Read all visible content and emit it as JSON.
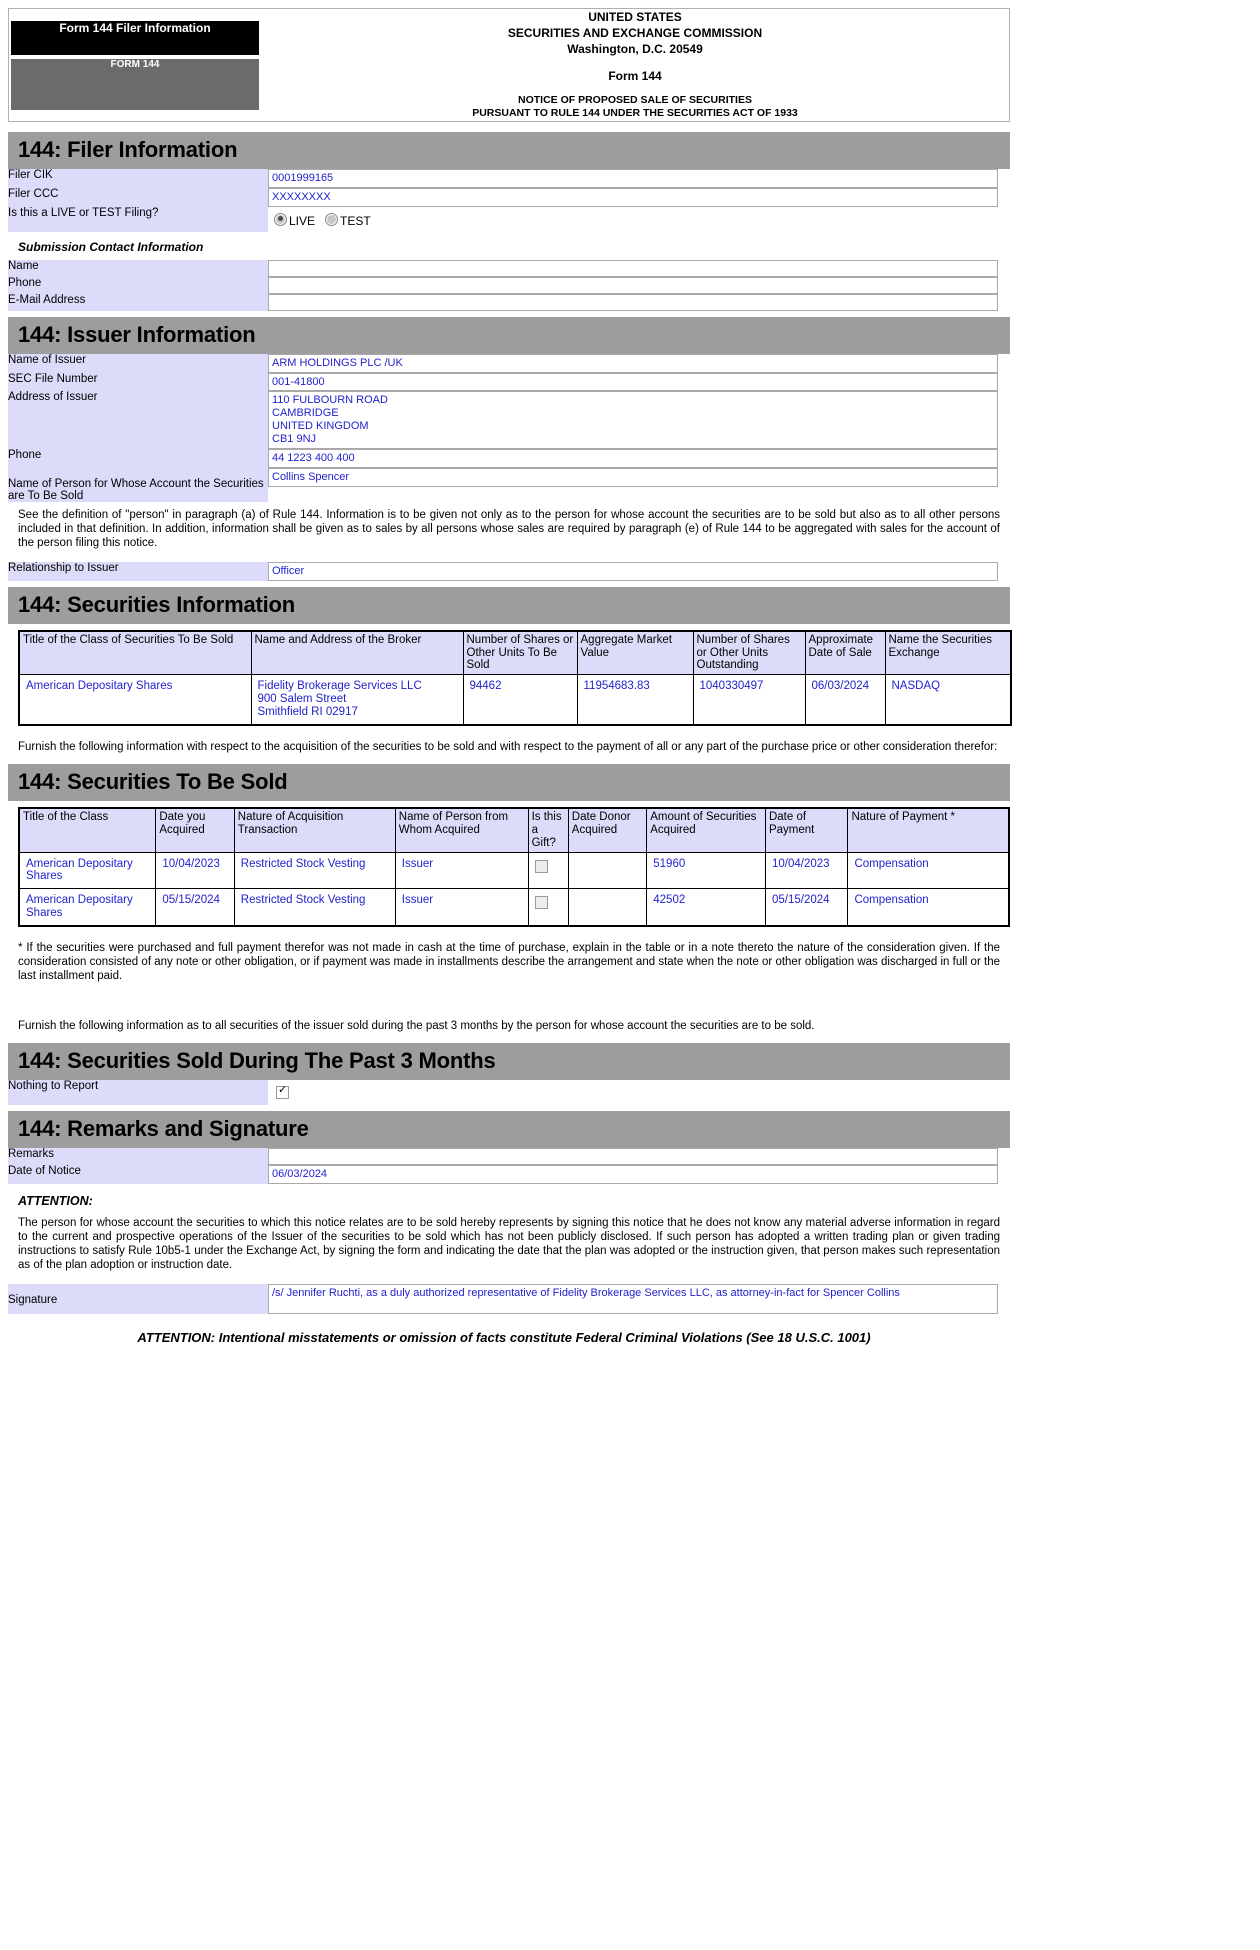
{
  "masthead": {
    "tab_label": "Form 144 Filer Information",
    "form_tag": "FORM 144",
    "line1": "UNITED STATES",
    "line2": "SECURITIES AND EXCHANGE COMMISSION",
    "line3": "Washington, D.C. 20549",
    "form_title": "Form 144",
    "notice1": "NOTICE OF PROPOSED SALE OF SECURITIES",
    "notice2": "PURSUANT TO RULE 144 UNDER THE SECURITIES ACT OF 1933"
  },
  "filer_section": {
    "heading": "144: Filer Information",
    "cik_label": "Filer CIK",
    "cik_value": "0001999165",
    "ccc_label": "Filer CCC",
    "ccc_value": "XXXXXXXX",
    "live_test_label": "Is this a LIVE or TEST Filing?",
    "live_label": "LIVE",
    "test_label": "TEST",
    "live_selected": true,
    "contact_subhead": "Submission Contact Information",
    "contact_name_label": "Name",
    "contact_name_value": "",
    "contact_phone_label": "Phone",
    "contact_phone_value": "",
    "contact_email_label": "E-Mail Address",
    "contact_email_value": ""
  },
  "issuer_section": {
    "heading": "144: Issuer Information",
    "name_label": "Name of Issuer",
    "name_value": "ARM HOLDINGS PLC /UK",
    "sec_file_label": "SEC File Number",
    "sec_file_value": "001-41800",
    "address_label": "Address of Issuer",
    "address_value": "110 FULBOURN ROAD\nCAMBRIDGE\nUNITED KINGDOM\nCB1 9NJ",
    "phone_label": "Phone",
    "phone_value": "44 1223 400 400",
    "person_label": "Name of Person for Whose Account the Securities are To Be Sold",
    "person_value": "Collins Spencer",
    "definition_paragraph": "See the definition of \"person\" in paragraph (a) of Rule 144. Information is to be given not only as to the person for whose account the securities are to be sold but also as to all other persons included in that definition. In addition, information shall be given as to sales by all persons whose sales are required by paragraph (e) of Rule 144 to be aggregated with sales for the account of the person filing this notice.",
    "relationship_label": "Relationship to Issuer",
    "relationship_value": "Officer"
  },
  "securities_info": {
    "heading": "144: Securities Information",
    "columns": [
      "Title of the Class of Securities To Be Sold",
      "Name and Address of the Broker",
      "Number of Shares or Other Units To Be Sold",
      "Aggregate Market Value",
      "Number of Shares or Other Units Outstanding",
      "Approximate Date of Sale",
      "Name the Securities Exchange"
    ],
    "rows": [
      {
        "title": "American Depositary Shares",
        "broker": "Fidelity Brokerage Services LLC\n900 Salem Street\nSmithfield  RI  02917",
        "units_to_sell": "94462",
        "market_value": "11954683.83",
        "units_outstanding": "1040330497",
        "date_of_sale": "06/03/2024",
        "exchange": "NASDAQ"
      }
    ]
  },
  "furnish_paragraph_1": "Furnish the following information with respect to the acquisition of the securities to be sold and with respect to the payment of all or any part of the purchase price or other consideration therefor:",
  "securities_to_be_sold": {
    "heading": "144: Securities To Be Sold",
    "columns": [
      "Title of the Class",
      "Date you Acquired",
      "Nature of Acquisition Transaction",
      "Name of Person from Whom Acquired",
      "Is this a Gift?",
      "Date Donor Acquired",
      "Amount of Securities Acquired",
      "Date of Payment",
      "Nature of Payment *"
    ],
    "rows": [
      {
        "title": "American Depositary Shares",
        "date_acquired": "10/04/2023",
        "nature": "Restricted Stock Vesting",
        "from_whom": "Issuer",
        "is_gift": false,
        "donor_date": "",
        "amount": "51960",
        "date_of_payment": "10/04/2023",
        "nature_of_payment": "Compensation"
      },
      {
        "title": "American Depositary Shares",
        "date_acquired": "05/15/2024",
        "nature": "Restricted Stock Vesting",
        "from_whom": "Issuer",
        "is_gift": false,
        "donor_date": "",
        "amount": "42502",
        "date_of_payment": "05/15/2024",
        "nature_of_payment": "Compensation"
      }
    ]
  },
  "footnote": "* If the securities were purchased and full payment therefor was not made in cash at the time of purchase, explain in the table or in a note thereto the nature of the consideration given. If the consideration consisted of any note or other obligation, or if payment was made in installments describe the arrangement and state when the note or other obligation was discharged in full or the last installment paid.",
  "furnish_paragraph_2": "Furnish the following information as to all securities of the issuer sold during the past 3 months by the person for whose account the securities are to be sold.",
  "sold_past_3_months": {
    "heading": "144: Securities Sold During The Past 3 Months",
    "nothing_label": "Nothing to Report",
    "nothing_checked": true
  },
  "remarks_section": {
    "heading": "144: Remarks and Signature",
    "remarks_label": "Remarks",
    "remarks_value": "",
    "date_of_notice_label": "Date of Notice",
    "date_of_notice_value": "06/03/2024",
    "attention_title": "ATTENTION:",
    "attention_paragraph": "The person for whose account the securities to which this notice relates are to be sold hereby represents by signing this notice that he does not know any material adverse information in regard to the current and prospective operations of the Issuer of the securities to be sold which has not been publicly disclosed. If such person has adopted a written trading plan or given trading instructions to satisfy Rule 10b5-1 under the Exchange Act, by signing the form and indicating the date that the plan was adopted or the instruction given, that person makes such representation as of the plan adoption or instruction date.",
    "signature_label": "Signature",
    "signature_value": "/s/ Jennifer Ruchti, as a duly authorized representative of Fidelity Brokerage Services LLC, as attorney-in-fact for Spencer Collins"
  },
  "footer_note": "ATTENTION: Intentional misstatements or omission of facts constitute Federal Criminal Violations (See 18 U.S.C. 1001)",
  "colors": {
    "section_bar": "#9d9d9d",
    "label_bg": "#dcdcfa",
    "value_text": "#2222cc",
    "tab_black": "#000000",
    "tab_gray": "#6b6b6b"
  }
}
